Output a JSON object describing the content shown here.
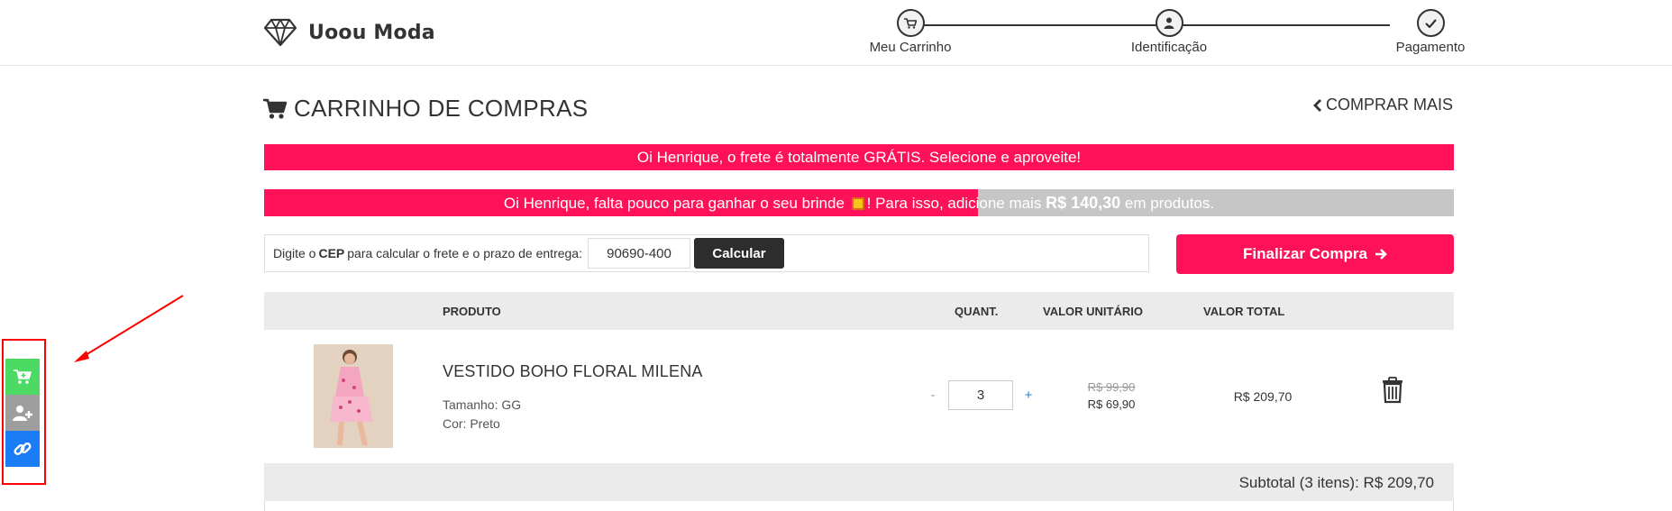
{
  "header": {
    "brand": "Uoou Moda",
    "steps": [
      {
        "label": "Meu Carrinho",
        "icon": "cart-icon"
      },
      {
        "label": "Identificação",
        "icon": "user-icon"
      },
      {
        "label": "Pagamento",
        "icon": "check-icon"
      }
    ]
  },
  "page": {
    "title": "CARRINHO DE COMPRAS",
    "buy_more": "COMPRAR MAIS"
  },
  "banners": {
    "free_shipping": "Oi Henrique, o frete é totalmente GRÁTIS. Selecione e aproveite!",
    "gift_part1": "Oi Henrique, falta pouco para ganhar o seu brinde",
    "gift_part2": "! Para isso, adicione mais",
    "gift_amount": "R$ 140,30",
    "gift_part3": "em produtos.",
    "gift_progress_percent": 60
  },
  "shipping": {
    "label_pre": "Digite o",
    "label_bold": "CEP",
    "label_post": "para calcular o frete e o prazo de entrega:",
    "cep_value": "90690-400",
    "calc_button": "Calcular"
  },
  "checkout": {
    "finalize_label": "Finalizar Compra"
  },
  "table": {
    "headers": [
      "PRODUTO",
      "QUANT.",
      "VALOR UNITÁRIO",
      "VALOR TOTAL"
    ],
    "items": [
      {
        "name": "VESTIDO BOHO FLORAL MILENA",
        "size": "Tamanho: GG",
        "color": "Cor: Preto",
        "quantity": "3",
        "minus": "-",
        "plus": "+",
        "old_price": "R$ 99,90",
        "unit_price": "R$ 69,90",
        "total": "R$ 209,70"
      }
    ],
    "subtotal": "Subtotal (3 itens): R$ 209,70"
  },
  "side_tools": [
    {
      "icon": "cart-add-icon",
      "color": "#4cd964"
    },
    {
      "icon": "add-user-icon",
      "color": "#9e9e9e"
    },
    {
      "icon": "link-icon",
      "color": "#1a7df5"
    }
  ],
  "colors": {
    "accent": "#ff1159",
    "progress_bg": "#c6c6c6",
    "annotation": "#ff0000"
  }
}
